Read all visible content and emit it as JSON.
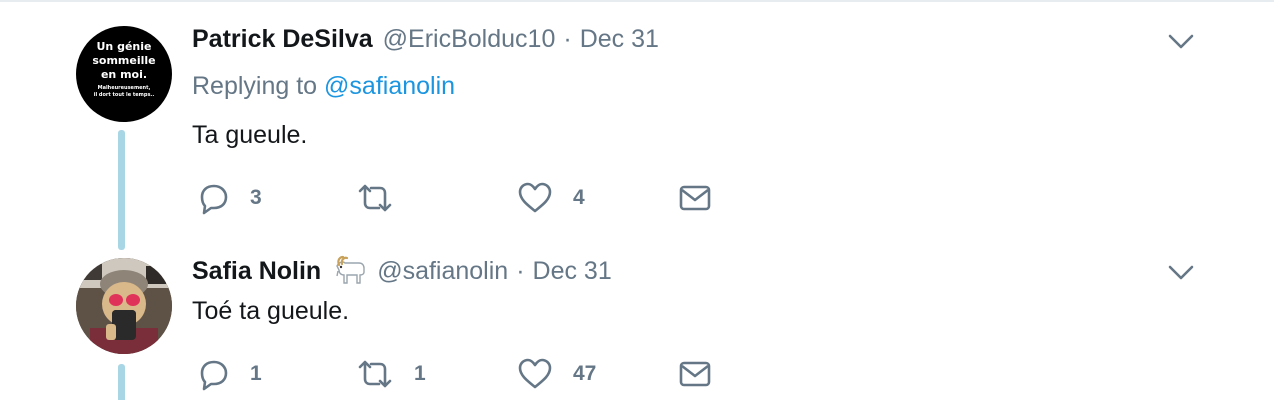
{
  "tweets": [
    {
      "author_name": "Patrick DeSilva",
      "handle": "@EricBolduc10",
      "separator": "·",
      "date": "Dec 31",
      "replying_prefix": "Replying to",
      "replying_handle": "@safianolin",
      "text": "Ta gueule.",
      "avatar_lines": [
        "Un génie",
        "sommeille",
        "en moi.",
        "Malheureusement,",
        "il dort tout le temps.."
      ],
      "avatar_color": "#000000",
      "replies": "3",
      "retweets": "",
      "likes": "4",
      "icons": [
        "reply-icon",
        "retweet-icon",
        "heart-icon",
        "mail-icon",
        "chevron-down-icon"
      ]
    },
    {
      "author_name": "Safia Nolin",
      "badge_icon": "goat-icon",
      "handle": "@safianolin",
      "separator": "·",
      "date": "Dec 31",
      "text": "Toé ta gueule.",
      "replies": "1",
      "retweets": "1",
      "likes": "47",
      "icons": [
        "reply-icon",
        "retweet-icon",
        "heart-icon",
        "mail-icon",
        "chevron-down-icon"
      ]
    }
  ],
  "colors": {
    "text": "#14171a",
    "muted": "#657786",
    "link": "#1b95e0",
    "thread_line": "#a9d6e5",
    "divider": "#e6ecf0"
  }
}
